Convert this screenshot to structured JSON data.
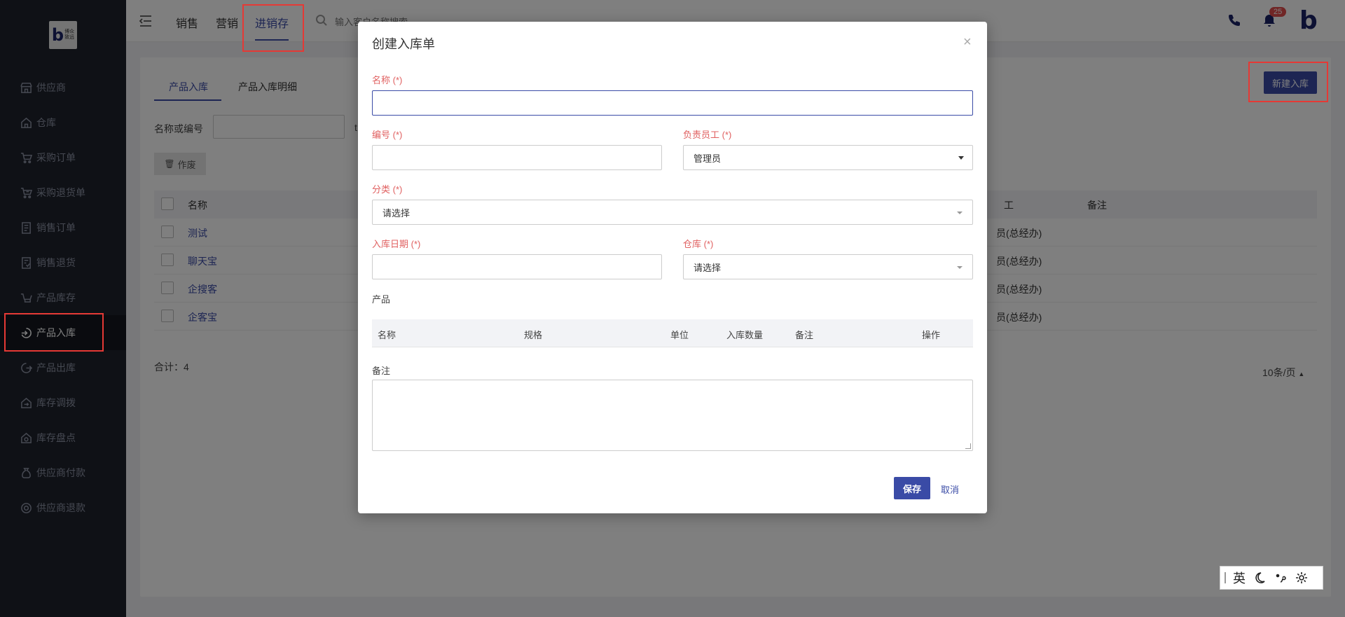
{
  "logo": {
    "mark": "b",
    "line1": "博众",
    "line2": "致远"
  },
  "sidebar": {
    "items": [
      {
        "label": "供应商",
        "icon": "store-icon"
      },
      {
        "label": "仓库",
        "icon": "warehouse-icon"
      },
      {
        "label": "采购订单",
        "icon": "cart-icon"
      },
      {
        "label": "采购退货单",
        "icon": "cart-return-icon"
      },
      {
        "label": "销售订单",
        "icon": "order-icon"
      },
      {
        "label": "销售退货",
        "icon": "sale-return-icon"
      },
      {
        "label": "产品库存",
        "icon": "inventory-icon"
      },
      {
        "label": "产品入库",
        "icon": "stock-in-icon"
      },
      {
        "label": "产品出库",
        "icon": "stock-out-icon"
      },
      {
        "label": "库存调拨",
        "icon": "transfer-icon"
      },
      {
        "label": "库存盘点",
        "icon": "stocktake-icon"
      },
      {
        "label": "供应商付款",
        "icon": "payment-icon"
      },
      {
        "label": "供应商退款",
        "icon": "refund-icon"
      }
    ],
    "active_index": 7
  },
  "topbar": {
    "tabs": [
      "销售",
      "营销",
      "进销存"
    ],
    "active_tab": "进销存",
    "search_placeholder": "输入客户名称搜索",
    "notification_count": "25",
    "brand_mark": "b"
  },
  "page": {
    "tabs": [
      "产品入库",
      "产品入库明细"
    ],
    "new_button": "新建入库",
    "filter_label": "名称或编号",
    "filter_label_cut": "t",
    "void_button": "作废",
    "table": {
      "headers": [
        "名称",
        "工",
        "备注"
      ],
      "rows": [
        {
          "name": "测试",
          "staff": "员(总经办)"
        },
        {
          "name": "聊天宝",
          "staff": "员(总经办)"
        },
        {
          "name": "企搜客",
          "staff": "员(总经办)"
        },
        {
          "name": "企客宝",
          "staff": "员(总经办)"
        }
      ]
    },
    "total": "合计：4",
    "page_size": "10条/页"
  },
  "modal": {
    "title": "创建入库单",
    "close": "×",
    "fields": {
      "name_label": "名称 (*)",
      "name_value": "",
      "code_label": "编号 (*)",
      "code_value": "",
      "staff_label": "负责员工 (*)",
      "staff_value": "管理员",
      "category_label": "分类 (*)",
      "category_value": "请选择",
      "date_label": "入库日期 (*)",
      "date_value": "",
      "warehouse_label": "仓库 (*)",
      "warehouse_value": "请选择"
    },
    "products_label": "产品",
    "product_headers": [
      "名称",
      "规格",
      "单位",
      "入库数量",
      "备注",
      "操作"
    ],
    "remark_label": "备注",
    "save": "保存",
    "cancel": "取消"
  },
  "ime": {
    "lang": "英"
  },
  "colors": {
    "accent": "#3a4ba6",
    "sidebar_bg": "#1e222d",
    "required": "#e06060",
    "highlight": "#e53935"
  }
}
